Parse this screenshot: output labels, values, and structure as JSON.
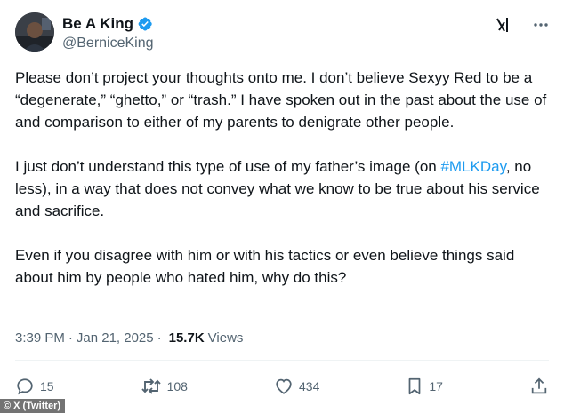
{
  "colors": {
    "text": "#0f1419",
    "secondary": "#536471",
    "link": "#1d9bf0",
    "verified": "#1d9bf0"
  },
  "user": {
    "display_name": "Be A King",
    "handle": "@BerniceKing",
    "verified_icon": "verified-badge-icon"
  },
  "tweet": {
    "paragraph1": "Please don’t project your thoughts onto me. I don’t believe Sexyy Red to be a “degenerate,” “ghetto,” or “trash.” I have spoken out in the past about the use of and comparison to either of my parents to denigrate other people.",
    "paragraph2_before": "I just don’t understand this type of use of my father’s image (on ",
    "hashtag": "#MLKDay",
    "paragraph2_after": ", no less), in a way that does not convey what we know to be true about his service and sacrifice.",
    "paragraph3": "Even if you disagree with him or with his tactics or even believe things said about him by people who hated him, why do this?"
  },
  "meta": {
    "time": "3:39 PM",
    "separator": "·",
    "date": "Jan 21, 2025",
    "views_count": "15.7K",
    "views_label": "Views"
  },
  "actions": {
    "replies": "15",
    "reposts": "108",
    "likes": "434",
    "bookmarks": "17"
  },
  "credit": "© X (Twitter)"
}
